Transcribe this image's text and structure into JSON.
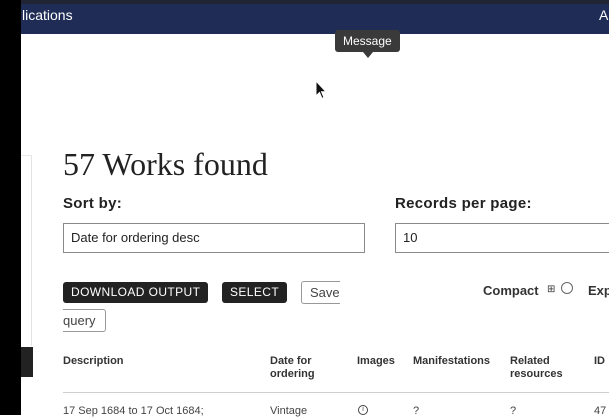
{
  "navbar": {
    "left_text": "lications",
    "right_text": "A"
  },
  "tooltip": {
    "text": "Message"
  },
  "heading": {
    "text": "57 Works found"
  },
  "sort": {
    "label": "Sort by:",
    "value": "Date for ordering desc"
  },
  "records": {
    "label": "Records per page:",
    "value": "10"
  },
  "actions": {
    "download_label": "DOWNLOAD OUTPUT",
    "select_label": "SELECT",
    "save_label": "Save",
    "query_label": "query"
  },
  "view": {
    "compact_label": "Compact",
    "compact_icon": "⊞",
    "expanded_label": "Exp"
  },
  "table": {
    "columns": [
      "Description",
      "Date for ordering",
      "Images",
      "Manifestations",
      "Related resources",
      "ID"
    ],
    "rows": [
      {
        "description": "17 Sep 1684 to 17 Oct 1684;",
        "date": "Vintage",
        "images": "i",
        "manifestations": "?",
        "related": "?",
        "id": "47"
      }
    ]
  }
}
